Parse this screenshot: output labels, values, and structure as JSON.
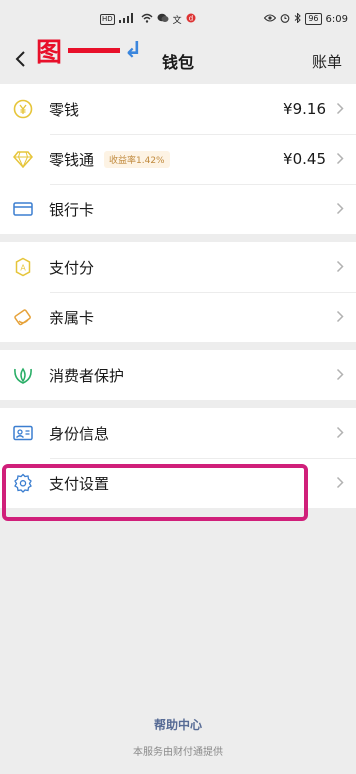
{
  "status_bar": {
    "left_hd": "HD",
    "left_icons": "⁴⁶",
    "time": "6:09",
    "battery": "96"
  },
  "annotation": {
    "label": "图",
    "arrow": "↲"
  },
  "nav": {
    "title": "钱包",
    "right_label": "账单"
  },
  "groups": [
    {
      "items": [
        {
          "name": "change",
          "label": "零钱",
          "value": "¥9.16",
          "icon": "yuan-coin-icon"
        },
        {
          "name": "lingqiantong",
          "label": "零钱通",
          "badge": "收益率1.42%",
          "value": "¥0.45",
          "icon": "diamond-icon"
        },
        {
          "name": "bank-card",
          "label": "银行卡",
          "icon": "card-icon"
        }
      ]
    },
    {
      "items": [
        {
          "name": "payment-score",
          "label": "支付分",
          "icon": "score-badge-icon"
        },
        {
          "name": "family-card",
          "label": "亲属卡",
          "icon": "family-card-icon"
        }
      ]
    },
    {
      "items": [
        {
          "name": "consumer-protection",
          "label": "消费者保护",
          "icon": "leaf-shield-icon"
        }
      ]
    },
    {
      "items": [
        {
          "name": "identity-info",
          "label": "身份信息",
          "icon": "id-card-icon"
        },
        {
          "name": "payment-settings",
          "label": "支付设置",
          "icon": "gear-icon"
        }
      ]
    }
  ],
  "footer": {
    "help": "帮助中心",
    "provider": "本服务由财付通提供"
  },
  "colors": {
    "accent_green": "#07c160",
    "annotation_red": "#e8102a",
    "highlight_magenta": "#d01f7a",
    "link_blue": "#576b95"
  }
}
